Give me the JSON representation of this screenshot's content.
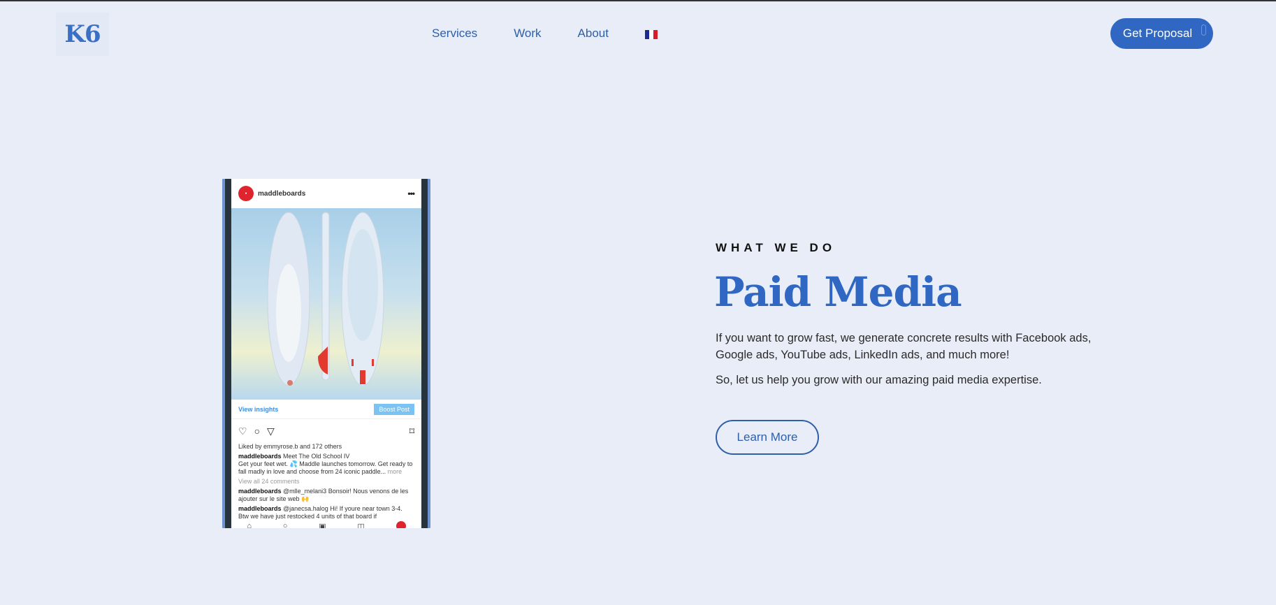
{
  "header": {
    "logo": "K6",
    "nav": [
      {
        "label": "Services"
      },
      {
        "label": "Work"
      },
      {
        "label": "About"
      }
    ],
    "language_flag": {
      "icon": "french-flag-icon",
      "colors": [
        "#1b2a8f",
        "#ffffff",
        "#d81e2a"
      ]
    },
    "cta_label": "Get Proposal"
  },
  "phone_mockup": {
    "username": "maddleboards",
    "insights_label": "View insights",
    "boost_label": "Boost Post",
    "likes_text": "Liked by emmyrose.b and 172 others",
    "caption_user": "maddleboards",
    "caption_title": "Meet The Old School IV",
    "caption_body": "Get your feet wet. 💦 Maddle launches tomorrow. Get ready to fall madly in love and choose from 24 iconic paddle...",
    "caption_more": "more",
    "view_comments": "View all 24 comments",
    "comment1_user": "maddleboards",
    "comment1_text": "@mlle_melani3 Bonsoir! Nous venons de les ajouter sur le site web 🙌",
    "comment2_user": "maddleboards",
    "comment2_text": "@janecsa.halog Hi! If youre near town 3-4. Btw we have just restocked 4 units of that board if"
  },
  "content": {
    "eyebrow": "WHAT WE DO",
    "title": "Paid Media",
    "paragraph1": "If you want to grow fast, we generate concrete results with Facebook ads, Google ads, YouTube ads, LinkedIn ads, and much more!",
    "paragraph2": "So, let us help you grow with our amazing paid media expertise.",
    "learn_more_label": "Learn More"
  },
  "colors": {
    "background": "#e8edf7",
    "accent": "#2f67c2",
    "nav_text": "#2f5fa8"
  }
}
